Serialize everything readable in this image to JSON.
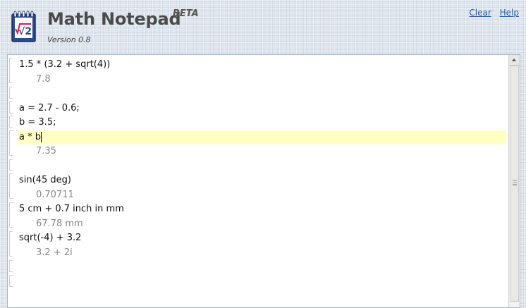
{
  "app": {
    "title": "Math Notepad",
    "badge": "BETA",
    "version": "Version 0.8"
  },
  "links": {
    "clear": "Clear",
    "help": "Help"
  },
  "logo": {
    "glyph": "√2",
    "icon": "notepad-sqrt-logo-icon"
  },
  "editor": {
    "lines": [
      {
        "text": "1.5 * (3.2 + sqrt(4))",
        "kind": "input"
      },
      {
        "text": "7.8",
        "kind": "result"
      },
      {
        "text": "",
        "kind": "input"
      },
      {
        "text": "a = 2.7 - 0.6;",
        "kind": "input"
      },
      {
        "text": "b = 3.5;",
        "kind": "input"
      },
      {
        "text": "a * b",
        "kind": "input",
        "active": true
      },
      {
        "text": "7.35",
        "kind": "result"
      },
      {
        "text": "",
        "kind": "input"
      },
      {
        "text": "sin(45 deg)",
        "kind": "input"
      },
      {
        "text": "0.70711",
        "kind": "result"
      },
      {
        "text": "5 cm + 0.7 inch in mm",
        "kind": "input"
      },
      {
        "text": "67.78 mm",
        "kind": "result"
      },
      {
        "text": "sqrt(-4) + 3.2",
        "kind": "input"
      },
      {
        "text": "3.2 + 2i",
        "kind": "result"
      },
      {
        "text": "",
        "kind": "input"
      },
      {
        "text": "",
        "kind": "input"
      },
      {
        "text": "",
        "kind": "input"
      }
    ]
  },
  "colors": {
    "accent_link": "#2a5a9c",
    "active_line": "#ffffc4",
    "result_text": "#888888"
  }
}
